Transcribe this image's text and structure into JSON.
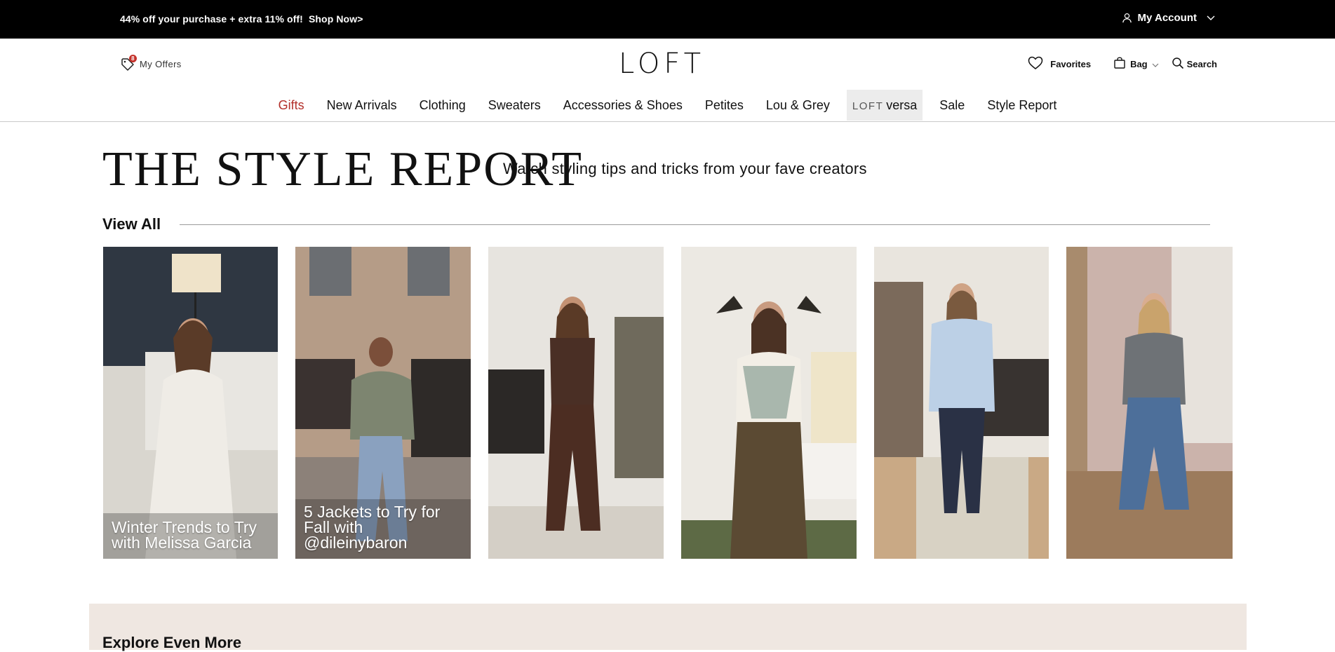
{
  "promo": {
    "text": "44% off your purchase + extra 11% off!",
    "cta": "Shop Now>"
  },
  "account": {
    "label": "My Account",
    "icon": "user-icon",
    "caret": "chevron-down-icon"
  },
  "offers": {
    "label": "My Offers",
    "badge": "8",
    "icon": "tag-icon"
  },
  "brand": {
    "logo": "LOFT"
  },
  "utilities": {
    "favorites": "Favorites",
    "bag": "Bag",
    "search": "Search"
  },
  "nav": {
    "items": [
      "Gifts",
      "New Arrivals",
      "Clothing",
      "Sweaters",
      "Accessories & Shoes",
      "Petites",
      "Lou & Grey"
    ],
    "versa_prefix": "LOFT",
    "versa_suffix": "versa",
    "items_after": [
      "Sale",
      "Style Report"
    ],
    "active_color": "#b32f2a"
  },
  "hero": {
    "title": "THE STYLE REPORT",
    "subtitle": "Watch styling tips and tricks from your fave creators"
  },
  "view_all": "View All",
  "videos": [
    {
      "caption": "Winter Trends to Try with Melissa Garcia"
    },
    {
      "caption": "5 Jackets to Try for Fall with @dileinybaron"
    },
    {
      "caption": ""
    },
    {
      "caption": ""
    },
    {
      "caption": ""
    },
    {
      "caption": ""
    }
  ],
  "explore": {
    "title": "Explore Even More",
    "background": "#efe7e1"
  }
}
